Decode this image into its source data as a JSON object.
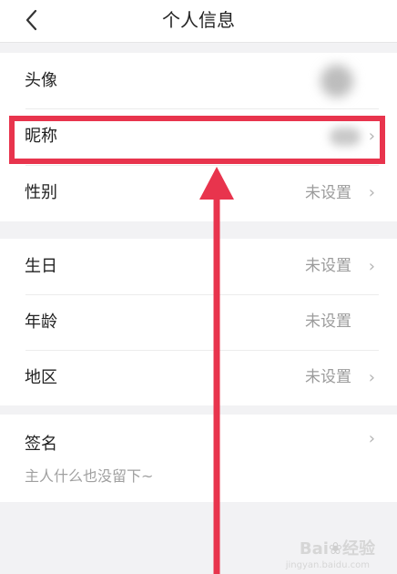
{
  "nav": {
    "title": "个人信息",
    "back_icon": "chevron-left-icon"
  },
  "rows": [
    {
      "label": "头像",
      "value": "",
      "arrow": false
    },
    {
      "label": "昵称",
      "value": "",
      "arrow": true
    },
    {
      "label": "性别",
      "value": "未设置",
      "arrow": true
    },
    {
      "label": "生日",
      "value": "未设置",
      "arrow": true
    },
    {
      "label": "年龄",
      "value": "未设置",
      "arrow": false
    },
    {
      "label": "地区",
      "value": "未设置",
      "arrow": true
    }
  ],
  "signature": {
    "label": "签名",
    "text": "主人什么也没留下~",
    "arrow": true
  },
  "annotation": {
    "color": "#e8344d"
  },
  "watermark": {
    "brand": "Bai du",
    "sub": "jingyan.baidu.com"
  },
  "chevron": "›"
}
